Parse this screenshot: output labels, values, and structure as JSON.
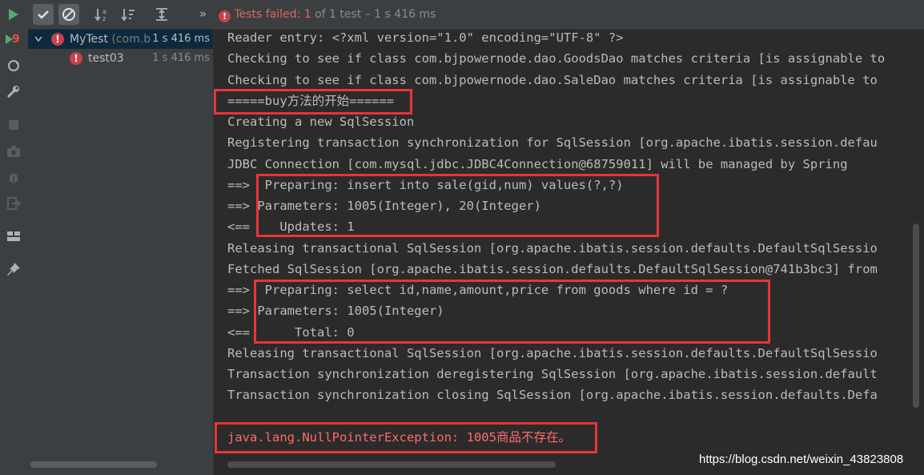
{
  "toolbar": {
    "chevron": "»",
    "status_failed": "Tests failed: 1",
    "status_rest": " of 1 test – 1 s 416 ms"
  },
  "tree": {
    "root": {
      "name": "MyTest",
      "package": " (com.b",
      "time": "1 s 416 ms",
      "icon": "error-icon"
    },
    "child": {
      "name": "test03",
      "time": "1 s 416 ms",
      "icon": "error-icon"
    }
  },
  "strip_icons": [
    "run-icon",
    "rerun-failed-icon",
    "toggle-auto-test-icon",
    "settings-wrench-icon",
    "stop-icon",
    "camera-icon",
    "debug-icon",
    "exit-icon",
    "layout-icon",
    "pin-icon"
  ],
  "strip_badge": "9",
  "console": {
    "lines": [
      "Reader entry: <?xml version=\"1.0\" encoding=\"UTF-8\" ?>",
      "Checking to see if class com.bjpowernode.dao.GoodsDao matches criteria [is assignable to",
      "Checking to see if class com.bjpowernode.dao.SaleDao matches criteria [is assignable to",
      "=====buy方法的开始======",
      "Creating a new SqlSession",
      "Registering transaction synchronization for SqlSession [org.apache.ibatis.session.defau",
      "JDBC Connection [com.mysql.jdbc.JDBC4Connection@68759011] will be managed by Spring",
      "==>  Preparing: insert into sale(gid,num) values(?,?)",
      "==> Parameters: 1005(Integer), 20(Integer)",
      "<==    Updates: 1",
      "Releasing transactional SqlSession [org.apache.ibatis.session.defaults.DefaultSqlSessio",
      "Fetched SqlSession [org.apache.ibatis.session.defaults.DefaultSqlSession@741b3bc3] from",
      "==>  Preparing: select id,name,amount,price from goods where id = ?",
      "==> Parameters: 1005(Integer)",
      "<==      Total: 0",
      "Releasing transactional SqlSession [org.apache.ibatis.session.defaults.DefaultSqlSessio",
      "Transaction synchronization deregistering SqlSession [org.apache.ibatis.session.default",
      "Transaction synchronization closing SqlSession [org.apache.ibatis.session.defaults.Defa",
      "",
      "java.lang.NullPointerException: 1005商品不存在。"
    ]
  },
  "watermark": "https://blog.csdn.net/weixin_43823808",
  "colors": {
    "error_text": "#ff6b68",
    "highlight_box": "#e8343a",
    "failed_status": "#e0675f"
  }
}
